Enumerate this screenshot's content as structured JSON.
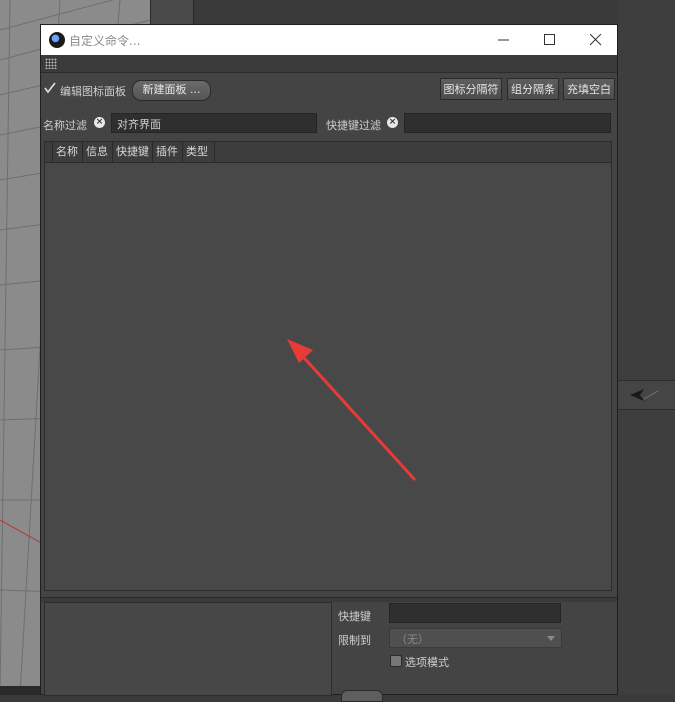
{
  "window": {
    "title": "自定义命令..."
  },
  "toolbar": {
    "edit_panel_label": "编辑图标面板",
    "edit_panel_checked": true,
    "new_panel_label": "新建面板 ...",
    "icon_separator_label": "图标分隔符",
    "group_separator_label": "组分隔条",
    "fill_blank_label": "充填空白"
  },
  "filters": {
    "name_filter_label": "名称过滤",
    "name_filter_value": "对齐界面",
    "shortcut_filter_label": "快捷键过滤",
    "shortcut_filter_value": ""
  },
  "list": {
    "columns": [
      "名称",
      "信息",
      "快捷键",
      "插件",
      "类型"
    ]
  },
  "details": {
    "shortcut_label": "快捷键",
    "shortcut_value": "",
    "restrict_label": "限制到",
    "restrict_value": "（无）",
    "option_mode_label": "选项模式",
    "option_mode_checked": false
  },
  "colors": {
    "dialog_bg": "#444444",
    "titlebar_bg": "#ffffff",
    "arrow": "#e63b36",
    "viewport_bg": "#8b8b8b"
  }
}
